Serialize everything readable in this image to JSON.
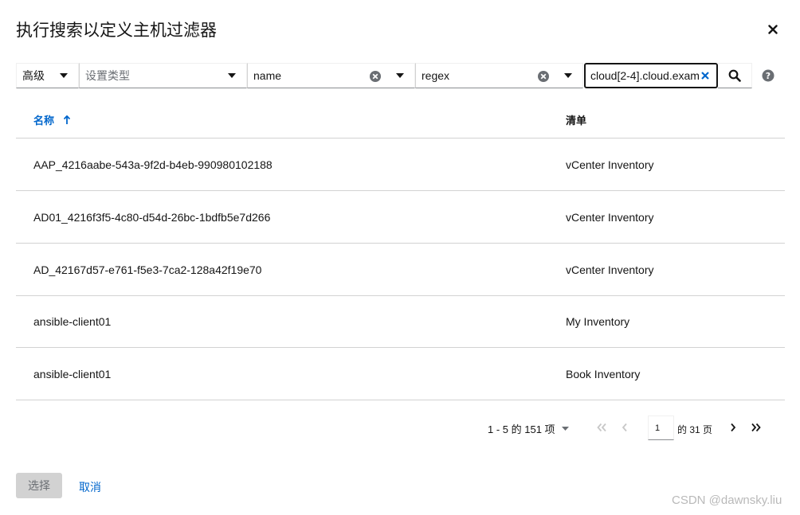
{
  "modal": {
    "title": "执行搜索以定义主机过滤器"
  },
  "toolbar": {
    "mode_label": "高级",
    "type_placeholder": "设置类型",
    "key_value": "name",
    "operator_value": "regex",
    "search_value": "cloud[2-4].cloud.exam"
  },
  "table": {
    "headers": {
      "name": "名称",
      "inventory": "清单"
    },
    "rows": [
      {
        "name": "AAP_4216aabe-543a-9f2d-b4eb-990980102188",
        "inventory": "vCenter Inventory"
      },
      {
        "name": "AD01_4216f3f5-4c80-d54d-26bc-1bdfb5e7d266",
        "inventory": "vCenter Inventory"
      },
      {
        "name": "AD_42167d57-e761-f5e3-7ca2-128a42f19e70",
        "inventory": "vCenter Inventory"
      },
      {
        "name": "ansible-client01",
        "inventory": "My Inventory"
      },
      {
        "name": "ansible-client01",
        "inventory": "Book Inventory"
      }
    ]
  },
  "pagination": {
    "count_text": "1 - 5 的 151 项",
    "current_page": "1",
    "of_text": "的 31 页"
  },
  "footer": {
    "select_label": "选择",
    "cancel_label": "取消"
  },
  "watermark": "CSDN @dawnsky.liu",
  "colors": {
    "link": "#0066cc",
    "border": "#d2d2d2",
    "disabled_bg": "#d2d2d2"
  }
}
